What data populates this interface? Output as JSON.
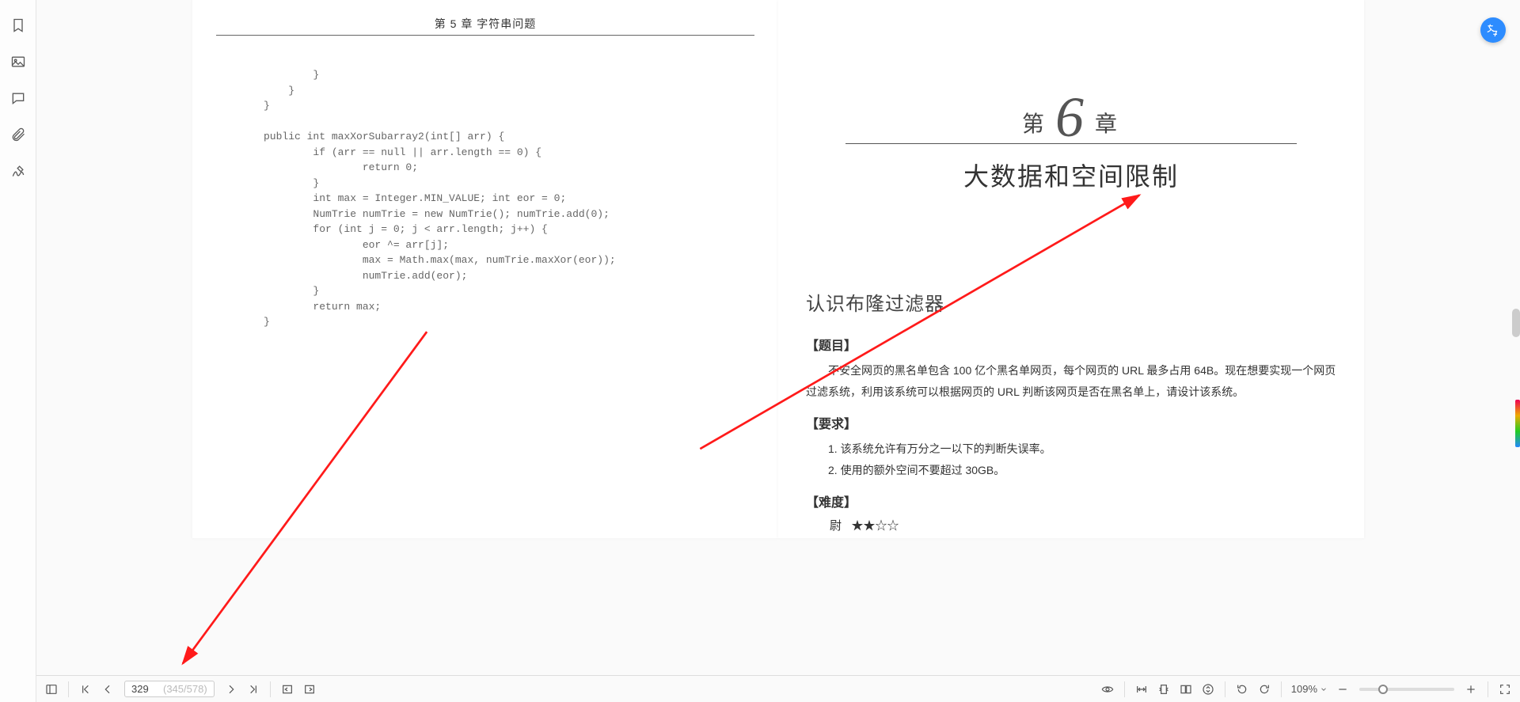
{
  "sidebar": {
    "icons": [
      "bookmark-icon",
      "image-icon",
      "comment-icon",
      "attachment-icon",
      "signature-icon"
    ]
  },
  "left_page": {
    "header": "第 5 章  字符串问题",
    "code": "        }\n    }\n}\n\npublic int maxXorSubarray2(int[] arr) {\n        if (arr == null || arr.length == 0) {\n                return 0;\n        }\n        int max = Integer.MIN_VALUE; int eor = 0;\n        NumTrie numTrie = new NumTrie(); numTrie.add(0);\n        for (int j = 0; j < arr.length; j++) {\n                eor ^= arr[j];\n                max = Math.max(max, numTrie.maxXor(eor));\n                numTrie.add(eor);\n        }\n        return max;\n}"
  },
  "right_page": {
    "chapter_pre": "第",
    "chapter_num": "6",
    "chapter_post": "章",
    "chapter_title": "大数据和空间限制",
    "section_title": "认识布隆过滤器",
    "subhead1": "【题目】",
    "body1": "不安全网页的黑名单包含 100 亿个黑名单网页，每个网页的 URL 最多占用 64B。现在想要实现一个网页过滤系统，利用该系统可以根据网页的 URL 判断该网页是否在黑名单上，请设计该系统。",
    "subhead2": "【要求】",
    "req1": "1.  该系统允许有万分之一以下的判断失误率。",
    "req2": "2.  使用的额外空间不要超过 30GB。",
    "subhead3": "【难度】",
    "difficulty_label": "尉",
    "difficulty_stars": "★★☆☆"
  },
  "bottombar": {
    "page_current": "329",
    "page_paren": "(345/578)",
    "zoom": "109%"
  },
  "float_button": {
    "name": "translate"
  }
}
